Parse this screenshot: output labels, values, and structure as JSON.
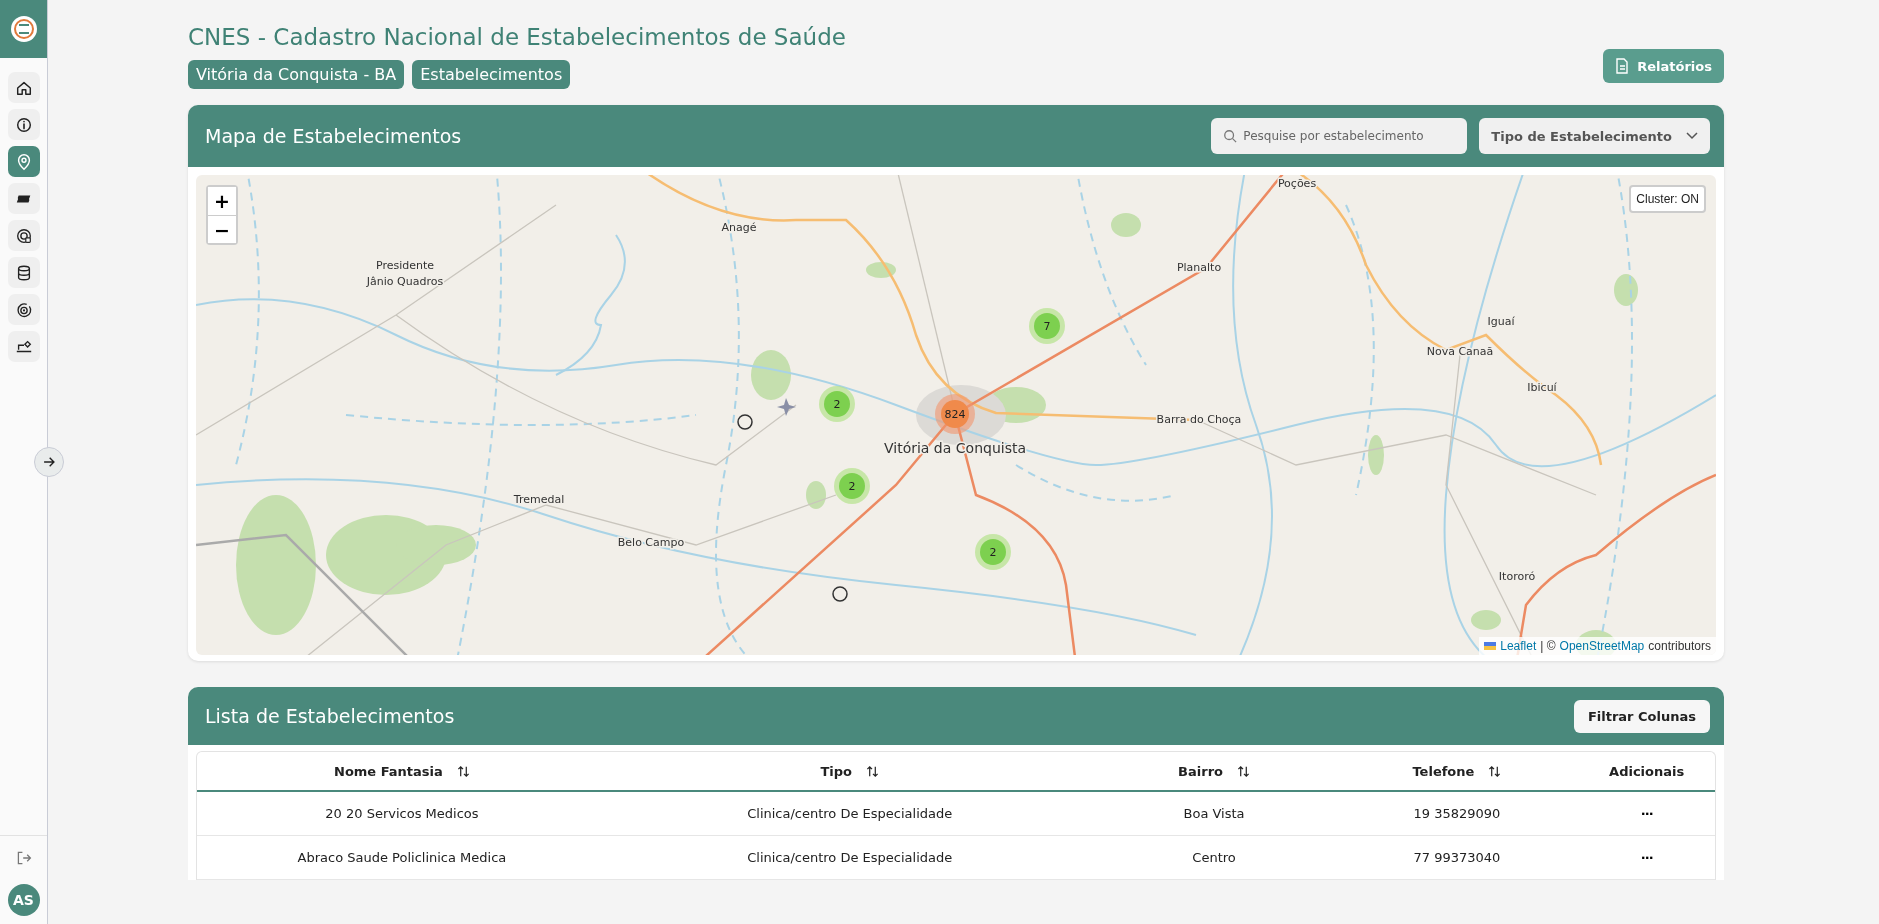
{
  "sidebar": {
    "items": [
      {
        "kind": "home",
        "selected": false
      },
      {
        "kind": "info",
        "selected": false
      },
      {
        "kind": "pin",
        "selected": true
      },
      {
        "kind": "ticket",
        "selected": false
      },
      {
        "kind": "target",
        "selected": false
      },
      {
        "kind": "database",
        "selected": false
      },
      {
        "kind": "radar",
        "selected": false
      },
      {
        "kind": "laptop",
        "selected": false
      }
    ],
    "avatar": "AS"
  },
  "header": {
    "title": "CNES - Cadastro Nacional de Estabelecimentos de Saúde",
    "breadcrumbs": [
      "Vitória da Conquista - BA",
      "Estabelecimentos"
    ],
    "reports_button": "Relatórios"
  },
  "map_panel": {
    "title": "Mapa de Estabelecimentos",
    "search": {
      "placeholder": "Pesquise por estabelecimento"
    },
    "type_filter": "Tipo de Estabelecimento",
    "zoom_in": "+",
    "zoom_out": "−",
    "cluster_toggle": "Cluster: ON",
    "attribution": {
      "leaflet": "Leaflet",
      "separator": "| ©",
      "osm": "OpenStreetMap",
      "suffix": "contributors"
    },
    "places": [
      "Poções",
      "Anagé",
      "Presidente",
      "Planalto",
      "Jânio Quadros",
      "Iguaí",
      "Nova Canaã",
      "Ibicuí",
      "Barra do Choça",
      "Vitória da Conquista",
      "Tremedal",
      "Belo Campo",
      "Itororó"
    ],
    "clusters": [
      {
        "count": "7",
        "kind": "small"
      },
      {
        "count": "2",
        "kind": "small"
      },
      {
        "count": "824",
        "kind": "large"
      },
      {
        "count": "2",
        "kind": "small"
      },
      {
        "count": "2",
        "kind": "small"
      }
    ]
  },
  "list_panel": {
    "title": "Lista de Estabelecimentos",
    "filter_button": "Filtrar Colunas",
    "columns": [
      {
        "label": "Nome Fantasia",
        "sortable": true
      },
      {
        "label": "Tipo",
        "sortable": true
      },
      {
        "label": "Bairro",
        "sortable": true
      },
      {
        "label": "Telefone",
        "sortable": true
      },
      {
        "label": "Adicionais",
        "sortable": false
      }
    ],
    "rows": [
      {
        "cells": [
          "20 20 Servicos Medicos",
          "Clinica/centro De Especialidade",
          "Boa Vista",
          "19 35829090"
        ],
        "actions": "···"
      },
      {
        "cells": [
          "Abraco Saude Policlinica Medica",
          "Clinica/centro De Especialidade",
          "Centro",
          "77 99373040"
        ],
        "actions": "···"
      }
    ]
  }
}
